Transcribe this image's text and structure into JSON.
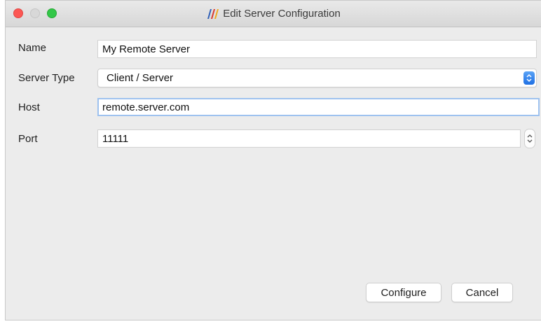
{
  "window": {
    "title": "Edit Server Configuration",
    "app_icon": "paraview-icon"
  },
  "form": {
    "name_label": "Name",
    "name_value": "My Remote Server",
    "server_type_label": "Server Type",
    "server_type_value": "Client / Server",
    "host_label": "Host",
    "host_value": "remote.server.com",
    "port_label": "Port",
    "port_value": "11111"
  },
  "buttons": {
    "configure_label": "Configure",
    "cancel_label": "Cancel"
  },
  "colors": {
    "close": "#fc5753",
    "minimize": "#d8d8d8",
    "maximize": "#33c748",
    "focus_ring": "#9ec2ef",
    "select_accent": "#1e6fe3"
  }
}
